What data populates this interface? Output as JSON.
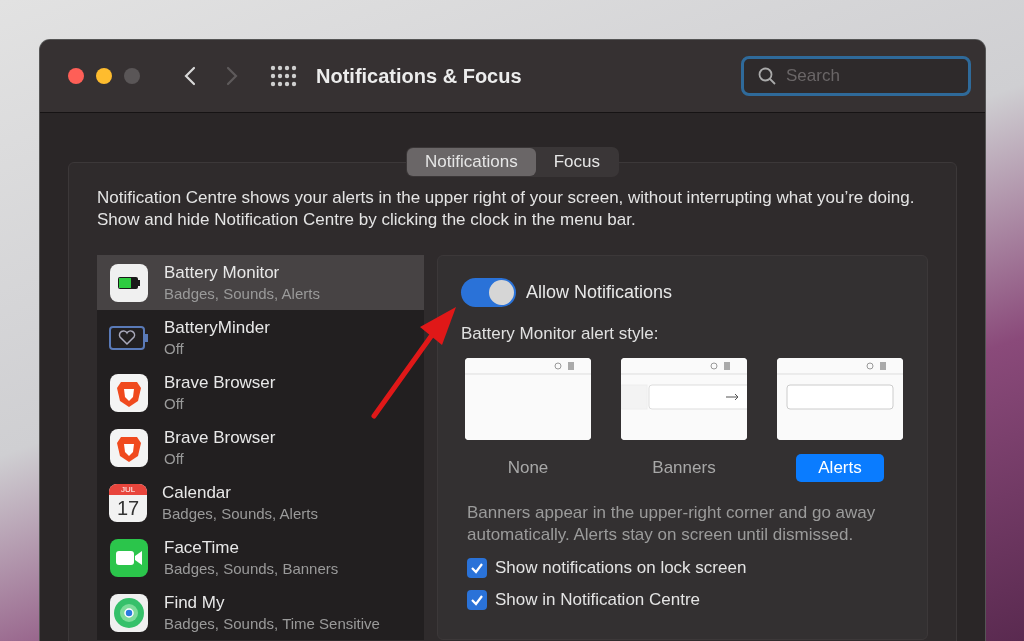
{
  "window": {
    "title": "Notifications & Focus"
  },
  "nav": [
    {
      "kind": "back",
      "disabled": false
    },
    {
      "kind": "forward",
      "disabled": true
    }
  ],
  "search": {
    "placeholder": "Search"
  },
  "tabs": [
    {
      "label": "Notifications",
      "selected": true
    },
    {
      "label": "Focus",
      "selected": false
    }
  ],
  "description": "Notification Centre shows your alerts in the upper right of your screen, without interrupting what you’re doing. Show and hide Notification Centre by clicking the clock in the menu bar.",
  "apps": [
    {
      "name": "Battery Monitor",
      "detail": "Badges, Sounds, Alerts",
      "kind": "battery",
      "selected": true
    },
    {
      "name": "BatteryMinder",
      "detail": "Off",
      "kind": "heart-battery",
      "selected": false
    },
    {
      "name": "Brave Browser",
      "detail": "Off",
      "kind": "lion",
      "selected": false
    },
    {
      "name": "Brave Browser",
      "detail": "Off",
      "kind": "lion",
      "selected": false
    },
    {
      "name": "Calendar",
      "detail": "Badges, Sounds, Alerts",
      "kind": "calendar",
      "icon_month": "JUL",
      "icon_day": "17",
      "selected": false
    },
    {
      "name": "FaceTime",
      "detail": "Badges, Sounds, Banners",
      "kind": "video",
      "selected": false
    },
    {
      "name": "Find My",
      "detail": "Badges, Sounds, Time Sensitive",
      "kind": "radar",
      "selected": false
    }
  ],
  "allow_notifications": {
    "label": "Allow Notifications",
    "on": true
  },
  "alert_style_label": "Battery Monitor alert style:",
  "alert_styles": [
    {
      "label": "None",
      "kind": "none",
      "selected": false
    },
    {
      "label": "Banners",
      "kind": "banners",
      "selected": false
    },
    {
      "label": "Alerts",
      "kind": "alerts",
      "selected": true
    }
  ],
  "alert_help": "Banners appear in the upper-right corner and go away automatically. Alerts stay on screen until dismissed.",
  "options": [
    {
      "label": "Show notifications on lock screen",
      "checked": true
    },
    {
      "label": "Show in Notification Centre",
      "checked": true
    }
  ]
}
